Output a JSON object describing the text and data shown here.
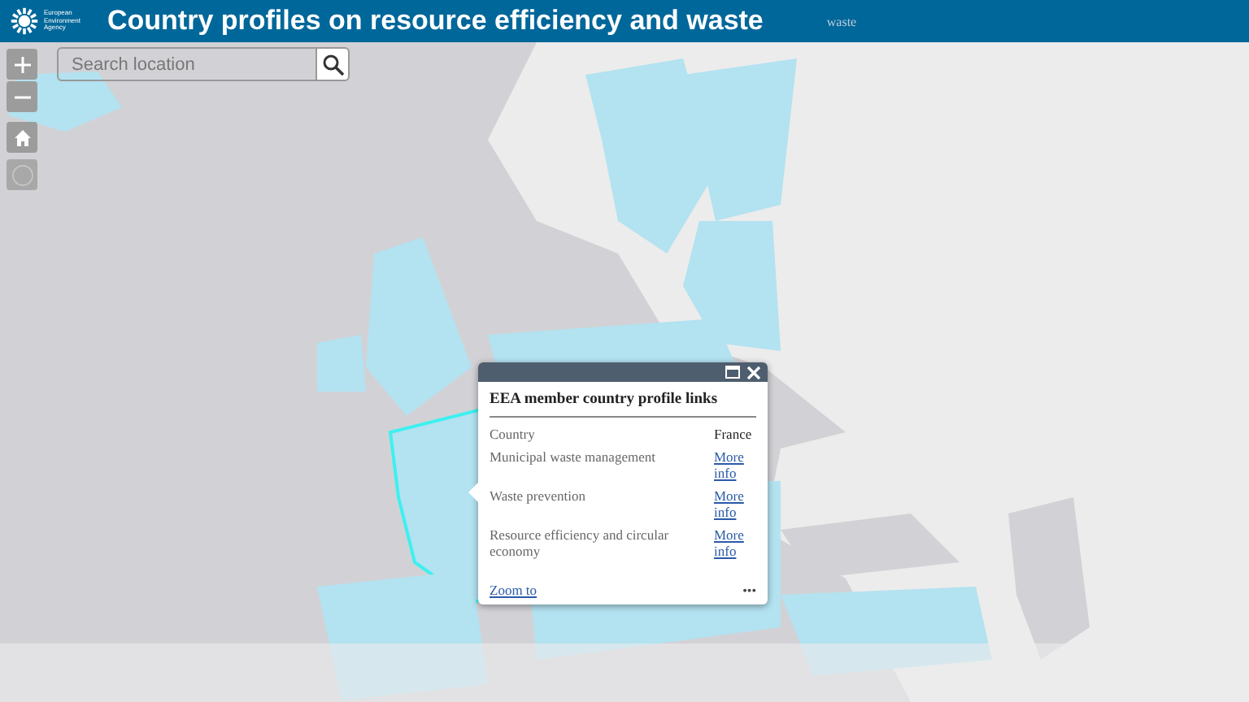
{
  "header": {
    "logo_text": "European Environment Agency",
    "title": "Country profiles on resource efficiency and waste",
    "subtitle": "waste"
  },
  "search": {
    "placeholder": "Search location"
  },
  "popup": {
    "title": "EEA member country profile links",
    "rows": [
      {
        "kind": "text",
        "label": "Country",
        "value": "France"
      },
      {
        "kind": "link",
        "label": "Municipal waste management",
        "value": "More info"
      },
      {
        "kind": "link",
        "label": "Waste prevention",
        "value": "More info"
      },
      {
        "kind": "link",
        "label": "Resource efficiency and circular economy",
        "value": "More info"
      }
    ],
    "zoom_link": "Zoom to",
    "menu": "•••"
  }
}
